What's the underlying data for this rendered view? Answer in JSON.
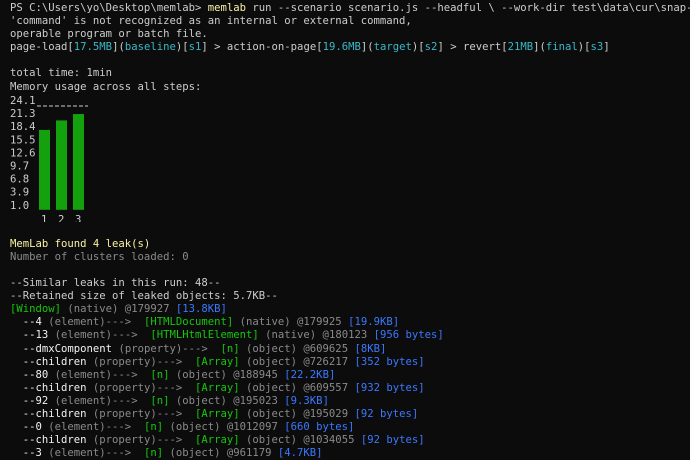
{
  "terminal": {
    "prompt": "PS C:\\Users\\yo\\Desktop\\memlab> ",
    "command_name": "memlab",
    "command_args": " run --scenario scenario.js --headful \\ --work-dir test\\data\\cur\\snap-seq.json",
    "error_line_1": "'command' is not recognized as an internal or external command,",
    "error_line_2": "operable program or batch file.",
    "steps_line": [
      {
        "text": "page-load[",
        "color": "default"
      },
      {
        "text": "17.5MB",
        "color": "cyan"
      },
      {
        "text": "](",
        "color": "default"
      },
      {
        "text": "baseline",
        "color": "cyan"
      },
      {
        "text": ")[",
        "color": "default"
      },
      {
        "text": "s1",
        "color": "cyan"
      },
      {
        "text": "] > action-on-page[",
        "color": "default"
      },
      {
        "text": "19.6MB",
        "color": "cyan"
      },
      {
        "text": "](",
        "color": "default"
      },
      {
        "text": "target",
        "color": "cyan"
      },
      {
        "text": ")[",
        "color": "default"
      },
      {
        "text": "s2",
        "color": "cyan"
      },
      {
        "text": "] > revert[",
        "color": "default"
      },
      {
        "text": "21MB",
        "color": "cyan"
      },
      {
        "text": "](",
        "color": "default"
      },
      {
        "text": "final",
        "color": "cyan"
      },
      {
        "text": ")[",
        "color": "default"
      },
      {
        "text": "s3",
        "color": "cyan"
      },
      {
        "text": "]",
        "color": "default"
      }
    ],
    "total_time": "total time: 1min",
    "memory_label": "Memory usage across all steps:",
    "found_leaks": "MemLab found 4 leak(s)",
    "clusters_loaded": "Number of clusters loaded: 0",
    "similar_leaks": "--Similar leaks in this run: 48--",
    "retained_size": "--Retained size of leaked objects: 5.7KB--",
    "trace_lines": [
      [
        {
          "text": "[Window]",
          "color": "green"
        },
        {
          "text": " (native) @179927 ",
          "color": "gray"
        },
        {
          "text": "[13.8KB]",
          "color": "blue"
        }
      ],
      [
        {
          "text": "  --4",
          "color": "white"
        },
        {
          "text": " (element)--->  ",
          "color": "gray"
        },
        {
          "text": "[HTMLDocument]",
          "color": "green"
        },
        {
          "text": " (native) @179925 ",
          "color": "gray"
        },
        {
          "text": "[19.9KB]",
          "color": "blue"
        }
      ],
      [
        {
          "text": "  --13",
          "color": "white"
        },
        {
          "text": " (element)--->  ",
          "color": "gray"
        },
        {
          "text": "[HTMLHtmlElement]",
          "color": "green"
        },
        {
          "text": " (native) @180123 ",
          "color": "gray"
        },
        {
          "text": "[956 bytes]",
          "color": "blue"
        }
      ],
      [
        {
          "text": "  --dmxComponent",
          "color": "white"
        },
        {
          "text": " (property)--->  ",
          "color": "gray"
        },
        {
          "text": "[n]",
          "color": "green"
        },
        {
          "text": " (object) @609625 ",
          "color": "gray"
        },
        {
          "text": "[8KB]",
          "color": "blue"
        }
      ],
      [
        {
          "text": "  --children",
          "color": "white"
        },
        {
          "text": " (property)--->  ",
          "color": "gray"
        },
        {
          "text": "[Array]",
          "color": "green"
        },
        {
          "text": " (object) @726217 ",
          "color": "gray"
        },
        {
          "text": "[352 bytes]",
          "color": "blue"
        }
      ],
      [
        {
          "text": "  --80",
          "color": "white"
        },
        {
          "text": " (element)--->  ",
          "color": "gray"
        },
        {
          "text": "[n]",
          "color": "green"
        },
        {
          "text": " (object) @188945 ",
          "color": "gray"
        },
        {
          "text": "[22.2KB]",
          "color": "blue"
        }
      ],
      [
        {
          "text": "  --children",
          "color": "white"
        },
        {
          "text": " (property)--->  ",
          "color": "gray"
        },
        {
          "text": "[Array]",
          "color": "green"
        },
        {
          "text": " (object) @609557 ",
          "color": "gray"
        },
        {
          "text": "[932 bytes]",
          "color": "blue"
        }
      ],
      [
        {
          "text": "  --92",
          "color": "white"
        },
        {
          "text": " (element)--->  ",
          "color": "gray"
        },
        {
          "text": "[n]",
          "color": "green"
        },
        {
          "text": " (object) @195023 ",
          "color": "gray"
        },
        {
          "text": "[9.3KB]",
          "color": "blue"
        }
      ],
      [
        {
          "text": "  --children",
          "color": "white"
        },
        {
          "text": " (property)--->  ",
          "color": "gray"
        },
        {
          "text": "[Array]",
          "color": "green"
        },
        {
          "text": " (object) @195029 ",
          "color": "gray"
        },
        {
          "text": "[92 bytes]",
          "color": "blue"
        }
      ],
      [
        {
          "text": "  --0",
          "color": "white"
        },
        {
          "text": " (element)--->  ",
          "color": "gray"
        },
        {
          "text": "[n]",
          "color": "green"
        },
        {
          "text": " (object) @1012097 ",
          "color": "gray"
        },
        {
          "text": "[660 bytes]",
          "color": "blue"
        }
      ],
      [
        {
          "text": "  --children",
          "color": "white"
        },
        {
          "text": " (property)--->  ",
          "color": "gray"
        },
        {
          "text": "[Array]",
          "color": "green"
        },
        {
          "text": " (object) @1034055 ",
          "color": "gray"
        },
        {
          "text": "[92 bytes]",
          "color": "blue"
        }
      ],
      [
        {
          "text": "  --3",
          "color": "white"
        },
        {
          "text": " (element)--->  ",
          "color": "gray"
        },
        {
          "text": "[n]",
          "color": "green"
        },
        {
          "text": " (object) @961179 ",
          "color": "gray"
        },
        {
          "text": "[4.7KB]",
          "color": "blue"
        }
      ]
    ],
    "colors": {
      "background": "#0c0c0c",
      "default": "#cccccc",
      "white": "#f2f2f2",
      "yellow": "#f9f1a5",
      "green": "#16c60c",
      "blue": "#3b78ff",
      "gray": "#8a8a8a",
      "cyan": "#3ab8c8",
      "bar": "#13a10e"
    }
  },
  "chart_data": {
    "type": "bar",
    "categories": [
      "1",
      "2",
      "3"
    ],
    "values": [
      17.5,
      19.6,
      21.0
    ],
    "yticks": [
      "24.1",
      "21.3",
      "18.4",
      "15.5",
      "12.6",
      "9.7",
      "6.8",
      "3.9",
      "1.0"
    ],
    "ylim": [
      1.0,
      24.1
    ],
    "title": "",
    "xlabel": "",
    "ylabel": "",
    "grid": false,
    "legend": "none"
  }
}
